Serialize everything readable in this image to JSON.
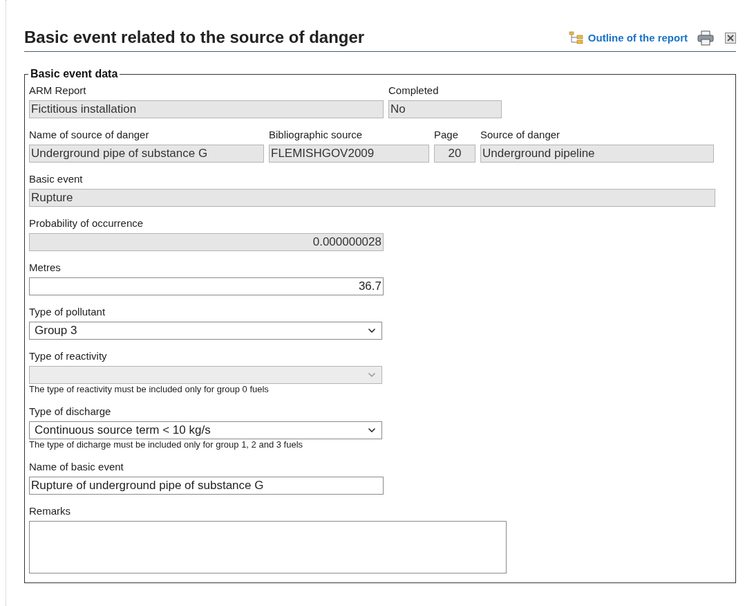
{
  "header": {
    "title": "Basic event related to the source of danger",
    "outline_link": "Outline of the report"
  },
  "fieldset": {
    "legend": "Basic event data",
    "rows": [
      {
        "fields": [
          {
            "label": "ARM Report",
            "value": "Fictitious installation",
            "kind": "text",
            "disabled": true
          },
          {
            "label": "Completed",
            "value": "No",
            "kind": "text",
            "disabled": true
          }
        ]
      },
      {
        "fields": [
          {
            "label": "Name of source of danger",
            "value": "Underground pipe of substance G",
            "kind": "text",
            "disabled": true
          },
          {
            "label": "Bibliographic source",
            "value": "FLEMISHGOV2009",
            "kind": "text",
            "disabled": true
          },
          {
            "label": "Page",
            "value": "20",
            "kind": "center",
            "disabled": true
          },
          {
            "label": "Source of danger",
            "value": "Underground pipeline",
            "kind": "text",
            "disabled": true
          }
        ]
      },
      {
        "fields": [
          {
            "label": "Basic event",
            "value": "Rupture",
            "kind": "text",
            "disabled": true
          }
        ]
      },
      {
        "fields": [
          {
            "label": "Probability of occurrence",
            "value": "0.000000028",
            "kind": "number",
            "disabled": true
          }
        ]
      },
      {
        "fields": [
          {
            "label": "Metres",
            "value": "36.7",
            "kind": "number",
            "disabled": false
          }
        ]
      },
      {
        "fields": [
          {
            "label": "Type of pollutant",
            "value": "Group 3",
            "kind": "select",
            "disabled": false
          }
        ]
      },
      {
        "fields": [
          {
            "label": "Type of reactivity",
            "kind": "select",
            "disabled": true,
            "hint": "The type of reactivity must be included only for group 0 fuels"
          }
        ]
      },
      {
        "fields": [
          {
            "label": "Type of discharge",
            "value": "Continuous source term < 10 kg/s",
            "kind": "select",
            "disabled": false,
            "hint": "The type of dicharge must be included only for group 1, 2 and 3 fuels"
          }
        ]
      },
      {
        "fields": [
          {
            "label": "Name of basic event",
            "value": "Rupture of underground pipe of substance G",
            "kind": "text",
            "disabled": false
          }
        ]
      },
      {
        "fields": [
          {
            "label": "Remarks",
            "kind": "textarea",
            "disabled": false
          }
        ]
      }
    ]
  }
}
